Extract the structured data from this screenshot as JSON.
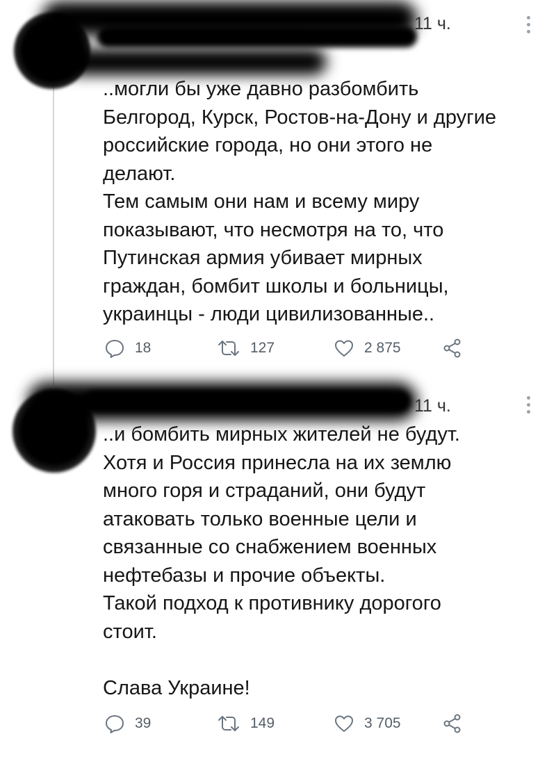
{
  "tweets": [
    {
      "time": "11 ч.",
      "text": "..могли бы уже давно разбомбить\nБелгород, Курск, Ростов-на-Дону и другие\nроссийские города, но они этого не\nделают.\nТем самым они нам и всему миру\nпоказывают, что несмотря на то, что\nПутинская армия убивает мирных\nграждан, бомбит школы и больницы,\nукраинцы - люди цивилизованные..",
      "replies": "18",
      "retweets": "127",
      "likes": "2 875"
    },
    {
      "time": "11 ч.",
      "text": "..и бомбить мирных жителей не будут.\nХотя и Россия принесла на их землю\nмного горя и страданий, они будут\nатаковать только военные цели и\nсвязанные со снабжением военных\nнефтебазы и прочие объекты.\nТакой подход к противнику дорогого\nстоит.\n\nСлава Украине!",
      "replies": "39",
      "retweets": "149",
      "likes": "3 705"
    }
  ],
  "icons": {
    "reply": "reply-icon",
    "retweet": "retweet-icon",
    "like": "heart-icon",
    "share": "share-icon",
    "more": "more-vertical-icon"
  },
  "colors": {
    "icon": "#6b7580",
    "thread_line": "#cfd9de"
  }
}
